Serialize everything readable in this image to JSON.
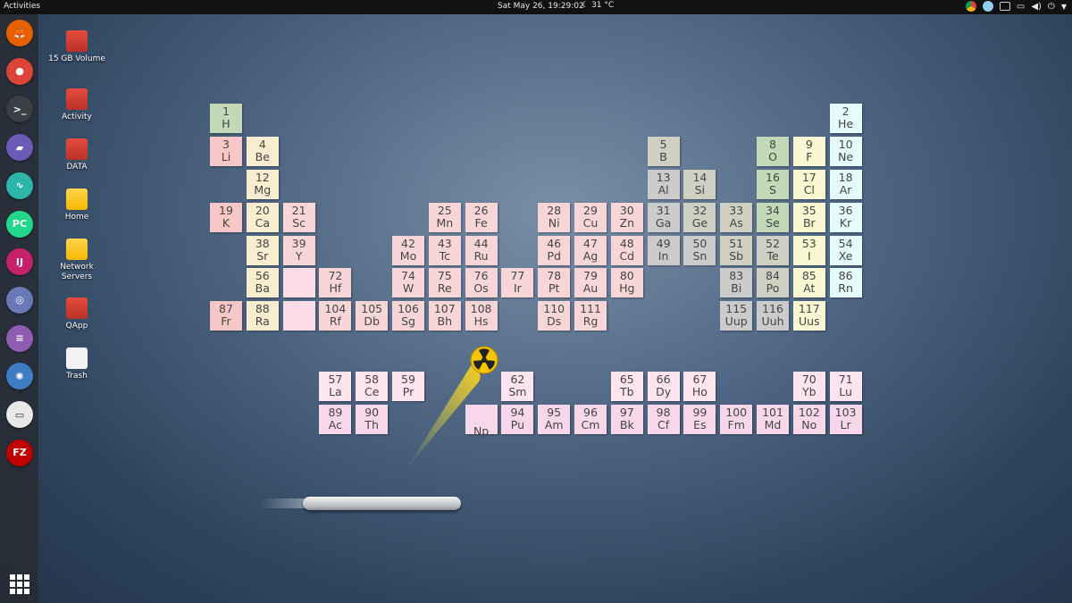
{
  "topbar": {
    "activities": "Activities",
    "clock": "Sat May 26, 19:29:02",
    "weather": "31 °C",
    "tray_icons": [
      "chrome-icon",
      "globe-icon",
      "keyboard-icon",
      "volume-icon",
      "screen-icon",
      "power-icon",
      "chevron-down-icon"
    ]
  },
  "dock": {
    "items": [
      {
        "name": "firefox",
        "color": "#e66000",
        "glyph": "🦊"
      },
      {
        "name": "chrome",
        "color": "#db4437",
        "glyph": "●"
      },
      {
        "name": "terminal",
        "color": "#3b3f45",
        "glyph": ">_"
      },
      {
        "name": "files",
        "color": "#6b5bb6",
        "glyph": "▰"
      },
      {
        "name": "system-monitor",
        "color": "#2ab7a9",
        "glyph": "∿"
      },
      {
        "name": "pycharm",
        "color": "#21d789",
        "glyph": "PC"
      },
      {
        "name": "intellij",
        "color": "#c8216b",
        "glyph": "IJ"
      },
      {
        "name": "disks",
        "color": "#6a79b8",
        "glyph": "◎"
      },
      {
        "name": "text-editor",
        "color": "#8e5cb3",
        "glyph": "≡"
      },
      {
        "name": "browser",
        "color": "#3e7cc3",
        "glyph": "✺"
      },
      {
        "name": "remote-desktop",
        "color": "#e8e8e8",
        "glyph": "▭"
      },
      {
        "name": "filezilla",
        "color": "#bf0000",
        "glyph": "FZ"
      }
    ]
  },
  "desktop_icons": [
    {
      "label": "15 GB Volume",
      "type": "drive"
    },
    {
      "label": "Activity",
      "type": "drive"
    },
    {
      "label": "DATA",
      "type": "drive"
    },
    {
      "label": "Home",
      "type": "folder"
    },
    {
      "label": "Network Servers",
      "type": "folder"
    },
    {
      "label": "QApp",
      "type": "drive"
    },
    {
      "label": "Trash",
      "type": "trash"
    }
  ],
  "elements": [
    {
      "n": "1",
      "s": "H",
      "c": "nonmetal",
      "col": 0,
      "row": 0
    },
    {
      "n": "2",
      "s": "He",
      "c": "noble",
      "col": 17,
      "row": 0
    },
    {
      "n": "3",
      "s": "Li",
      "c": "alkali",
      "col": 0,
      "row": 1
    },
    {
      "n": "4",
      "s": "Be",
      "c": "alkearth",
      "col": 1,
      "row": 1
    },
    {
      "n": "5",
      "s": "B",
      "c": "metalloid",
      "col": 12,
      "row": 1
    },
    {
      "n": "8",
      "s": "O",
      "c": "nonmetal",
      "col": 15,
      "row": 1
    },
    {
      "n": "9",
      "s": "F",
      "c": "halogen",
      "col": 16,
      "row": 1
    },
    {
      "n": "10",
      "s": "Ne",
      "c": "noble",
      "col": 17,
      "row": 1
    },
    {
      "n": "12",
      "s": "Mg",
      "c": "alkearth",
      "col": 1,
      "row": 2
    },
    {
      "n": "13",
      "s": "Al",
      "c": "post",
      "col": 12,
      "row": 2
    },
    {
      "n": "14",
      "s": "Si",
      "c": "metalloid",
      "col": 13,
      "row": 2
    },
    {
      "n": "16",
      "s": "S",
      "c": "nonmetal",
      "col": 15,
      "row": 2
    },
    {
      "n": "17",
      "s": "Cl",
      "c": "halogen",
      "col": 16,
      "row": 2
    },
    {
      "n": "18",
      "s": "Ar",
      "c": "noble",
      "col": 17,
      "row": 2
    },
    {
      "n": "19",
      "s": "K",
      "c": "alkali",
      "col": 0,
      "row": 3
    },
    {
      "n": "20",
      "s": "Ca",
      "c": "alkearth",
      "col": 1,
      "row": 3
    },
    {
      "n": "21",
      "s": "Sc",
      "c": "transition",
      "col": 2,
      "row": 3
    },
    {
      "n": "25",
      "s": "Mn",
      "c": "transition",
      "col": 6,
      "row": 3
    },
    {
      "n": "26",
      "s": "Fe",
      "c": "transition",
      "col": 7,
      "row": 3
    },
    {
      "n": "28",
      "s": "Ni",
      "c": "transition",
      "col": 9,
      "row": 3
    },
    {
      "n": "29",
      "s": "Cu",
      "c": "transition",
      "col": 10,
      "row": 3
    },
    {
      "n": "30",
      "s": "Zn",
      "c": "transition",
      "col": 11,
      "row": 3
    },
    {
      "n": "31",
      "s": "Ga",
      "c": "post",
      "col": 12,
      "row": 3
    },
    {
      "n": "32",
      "s": "Ge",
      "c": "metalloid",
      "col": 13,
      "row": 3
    },
    {
      "n": "33",
      "s": "As",
      "c": "metalloid",
      "col": 14,
      "row": 3
    },
    {
      "n": "34",
      "s": "Se",
      "c": "nonmetal",
      "col": 15,
      "row": 3
    },
    {
      "n": "35",
      "s": "Br",
      "c": "halogen",
      "col": 16,
      "row": 3
    },
    {
      "n": "36",
      "s": "Kr",
      "c": "noble",
      "col": 17,
      "row": 3
    },
    {
      "n": "38",
      "s": "Sr",
      "c": "alkearth",
      "col": 1,
      "row": 4
    },
    {
      "n": "39",
      "s": "Y",
      "c": "transition",
      "col": 2,
      "row": 4
    },
    {
      "n": "42",
      "s": "Mo",
      "c": "transition",
      "col": 5,
      "row": 4
    },
    {
      "n": "43",
      "s": "Tc",
      "c": "transition",
      "col": 6,
      "row": 4
    },
    {
      "n": "44",
      "s": "Ru",
      "c": "transition",
      "col": 7,
      "row": 4
    },
    {
      "n": "46",
      "s": "Pd",
      "c": "transition",
      "col": 9,
      "row": 4
    },
    {
      "n": "47",
      "s": "Ag",
      "c": "transition",
      "col": 10,
      "row": 4
    },
    {
      "n": "48",
      "s": "Cd",
      "c": "transition",
      "col": 11,
      "row": 4
    },
    {
      "n": "49",
      "s": "In",
      "c": "post",
      "col": 12,
      "row": 4
    },
    {
      "n": "50",
      "s": "Sn",
      "c": "post",
      "col": 13,
      "row": 4
    },
    {
      "n": "51",
      "s": "Sb",
      "c": "metalloid",
      "col": 14,
      "row": 4
    },
    {
      "n": "52",
      "s": "Te",
      "c": "metalloid",
      "col": 15,
      "row": 4
    },
    {
      "n": "53",
      "s": "I",
      "c": "halogen",
      "col": 16,
      "row": 4
    },
    {
      "n": "54",
      "s": "Xe",
      "c": "noble",
      "col": 17,
      "row": 4
    },
    {
      "n": "56",
      "s": "Ba",
      "c": "alkearth",
      "col": 1,
      "row": 5
    },
    {
      "n": "",
      "s": "",
      "c": "empty",
      "col": 2,
      "row": 5
    },
    {
      "n": "72",
      "s": "Hf",
      "c": "transition",
      "col": 3,
      "row": 5
    },
    {
      "n": "74",
      "s": "W",
      "c": "transition",
      "col": 5,
      "row": 5
    },
    {
      "n": "75",
      "s": "Re",
      "c": "transition",
      "col": 6,
      "row": 5
    },
    {
      "n": "76",
      "s": "Os",
      "c": "transition",
      "col": 7,
      "row": 5
    },
    {
      "n": "77",
      "s": "Ir",
      "c": "transition",
      "col": 8,
      "row": 5
    },
    {
      "n": "78",
      "s": "Pt",
      "c": "transition",
      "col": 9,
      "row": 5
    },
    {
      "n": "79",
      "s": "Au",
      "c": "transition",
      "col": 10,
      "row": 5
    },
    {
      "n": "80",
      "s": "Hg",
      "c": "transition",
      "col": 11,
      "row": 5
    },
    {
      "n": "83",
      "s": "Bi",
      "c": "post",
      "col": 14,
      "row": 5
    },
    {
      "n": "84",
      "s": "Po",
      "c": "metalloid",
      "col": 15,
      "row": 5
    },
    {
      "n": "85",
      "s": "At",
      "c": "halogen",
      "col": 16,
      "row": 5
    },
    {
      "n": "86",
      "s": "Rn",
      "c": "noble",
      "col": 17,
      "row": 5
    },
    {
      "n": "87",
      "s": "Fr",
      "c": "alkali",
      "col": 0,
      "row": 6
    },
    {
      "n": "88",
      "s": "Ra",
      "c": "alkearth",
      "col": 1,
      "row": 6
    },
    {
      "n": "",
      "s": "",
      "c": "empty",
      "col": 2,
      "row": 6
    },
    {
      "n": "104",
      "s": "Rf",
      "c": "transition",
      "col": 3,
      "row": 6
    },
    {
      "n": "105",
      "s": "Db",
      "c": "transition",
      "col": 4,
      "row": 6
    },
    {
      "n": "106",
      "s": "Sg",
      "c": "transition",
      "col": 5,
      "row": 6
    },
    {
      "n": "107",
      "s": "Bh",
      "c": "transition",
      "col": 6,
      "row": 6
    },
    {
      "n": "108",
      "s": "Hs",
      "c": "transition",
      "col": 7,
      "row": 6
    },
    {
      "n": "110",
      "s": "Ds",
      "c": "transition",
      "col": 9,
      "row": 6
    },
    {
      "n": "111",
      "s": "Rg",
      "c": "transition",
      "col": 10,
      "row": 6
    },
    {
      "n": "115",
      "s": "Uup",
      "c": "post",
      "col": 14,
      "row": 6
    },
    {
      "n": "116",
      "s": "Uuh",
      "c": "post",
      "col": 15,
      "row": 6
    },
    {
      "n": "117",
      "s": "Uus",
      "c": "halogen",
      "col": 16,
      "row": 6
    },
    {
      "n": "57",
      "s": "La",
      "c": "lan",
      "col": 3,
      "row": 7
    },
    {
      "n": "58",
      "s": "Ce",
      "c": "lan",
      "col": 4,
      "row": 7
    },
    {
      "n": "59",
      "s": "Pr",
      "c": "lan",
      "col": 5,
      "row": 7
    },
    {
      "n": "62",
      "s": "Sm",
      "c": "lan",
      "col": 8,
      "row": 7
    },
    {
      "n": "65",
      "s": "Tb",
      "c": "lan",
      "col": 11,
      "row": 7
    },
    {
      "n": "66",
      "s": "Dy",
      "c": "lan",
      "col": 12,
      "row": 7
    },
    {
      "n": "67",
      "s": "Ho",
      "c": "lan",
      "col": 13,
      "row": 7
    },
    {
      "n": "70",
      "s": "Yb",
      "c": "lan",
      "col": 16,
      "row": 7
    },
    {
      "n": "71",
      "s": "Lu",
      "c": "lan",
      "col": 17,
      "row": 7
    },
    {
      "n": "89",
      "s": "Ac",
      "c": "act",
      "col": 3,
      "row": 8
    },
    {
      "n": "90",
      "s": "Th",
      "c": "act",
      "col": 4,
      "row": 8
    },
    {
      "n": "",
      "s": "Np",
      "c": "act",
      "col": 7,
      "row": 8
    },
    {
      "n": "94",
      "s": "Pu",
      "c": "act",
      "col": 8,
      "row": 8
    },
    {
      "n": "95",
      "s": "Am",
      "c": "act",
      "col": 9,
      "row": 8
    },
    {
      "n": "96",
      "s": "Cm",
      "c": "act",
      "col": 10,
      "row": 8
    },
    {
      "n": "97",
      "s": "Bk",
      "c": "act",
      "col": 11,
      "row": 8
    },
    {
      "n": "98",
      "s": "Cf",
      "c": "act",
      "col": 12,
      "row": 8
    },
    {
      "n": "99",
      "s": "Es",
      "c": "act",
      "col": 13,
      "row": 8
    },
    {
      "n": "100",
      "s": "Fm",
      "c": "act",
      "col": 14,
      "row": 8
    },
    {
      "n": "101",
      "s": "Md",
      "c": "act",
      "col": 15,
      "row": 8
    },
    {
      "n": "102",
      "s": "No",
      "c": "act",
      "col": 16,
      "row": 8
    },
    {
      "n": "103",
      "s": "Lr",
      "c": "act",
      "col": 17,
      "row": 8
    }
  ],
  "game": {
    "ball_icon": "radiation-icon",
    "ball_color": "#f7c600",
    "paddle_icon": "paddle"
  }
}
